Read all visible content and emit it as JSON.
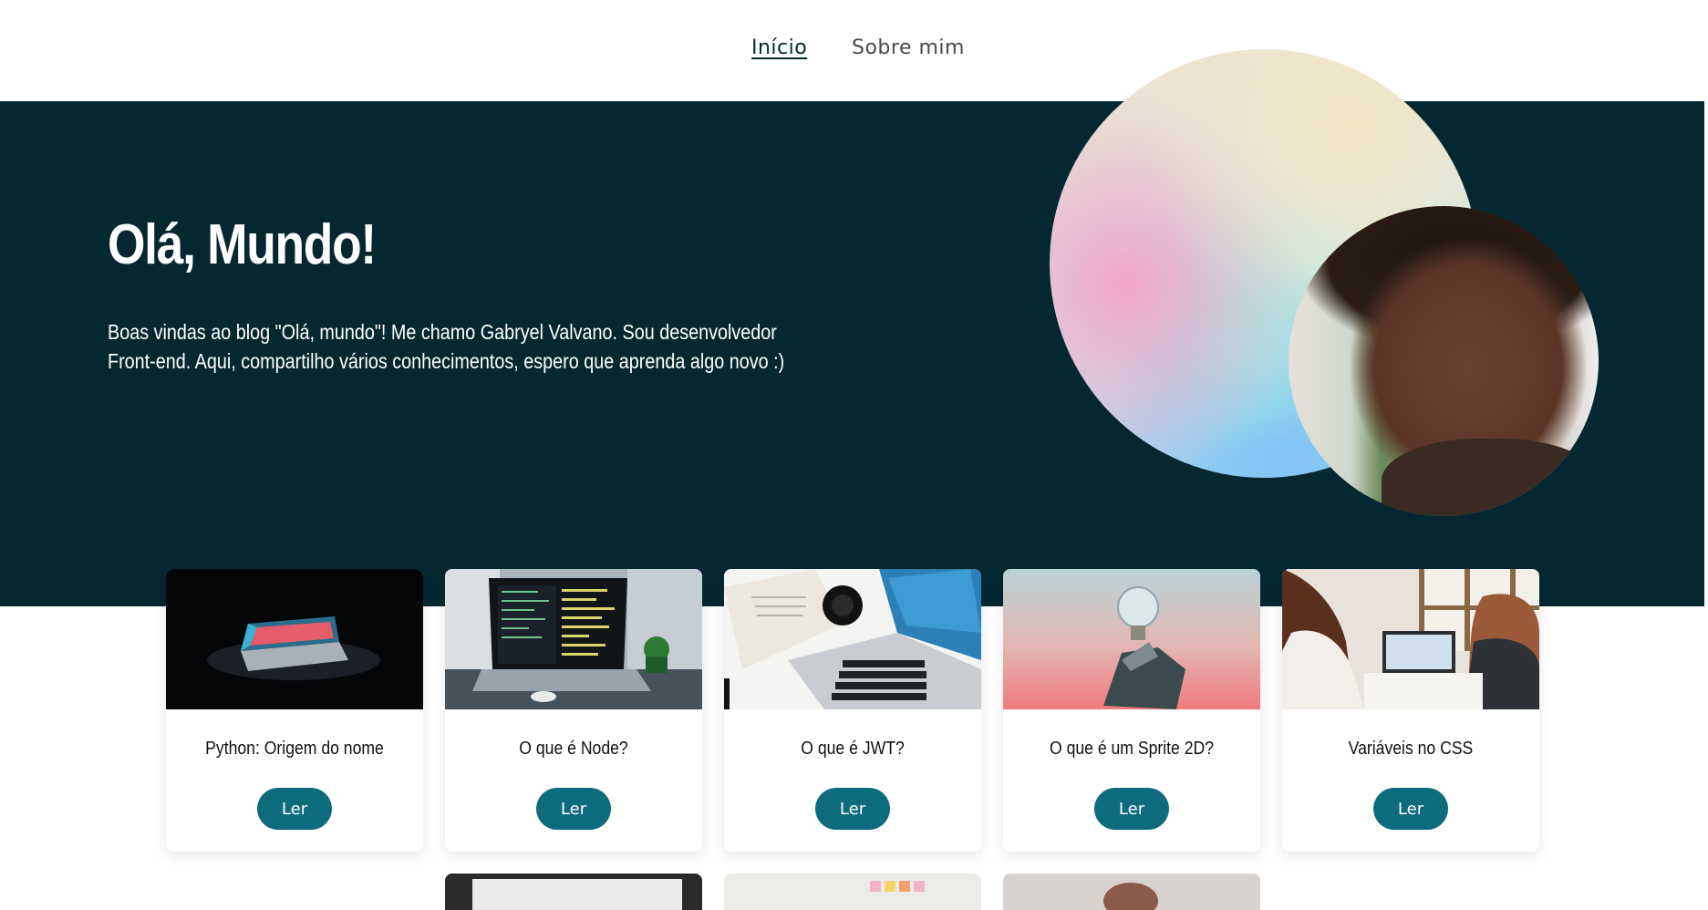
{
  "nav": {
    "items": [
      {
        "label": "Início",
        "active": true
      },
      {
        "label": "Sobre mim",
        "active": false
      }
    ]
  },
  "hero": {
    "title": "Olá, Mundo!",
    "description": "Boas vindas ao blog \"Olá, mundo\"! Me chamo Gabryel Valvano. Sou desenvolvedor Front-end. Aqui, compartilho vários conhecimentos, espero que aprenda algo novo :)"
  },
  "cards": [
    {
      "title": "Python: Origem do nome",
      "button": "Ler",
      "image": "dark-laptop"
    },
    {
      "title": "O que é Node?",
      "button": "Ler",
      "image": "laptop-code"
    },
    {
      "title": "O que é JWT?",
      "button": "Ler",
      "image": "laptop-desk"
    },
    {
      "title": "O que é um Sprite 2D?",
      "button": "Ler",
      "image": "lightbulb"
    },
    {
      "title": "Variáveis no CSS",
      "button": "Ler",
      "image": "people-computer"
    }
  ],
  "colors": {
    "hero_bg": "#052830",
    "button": "#0e6a7d",
    "text_dark": "#111111"
  }
}
